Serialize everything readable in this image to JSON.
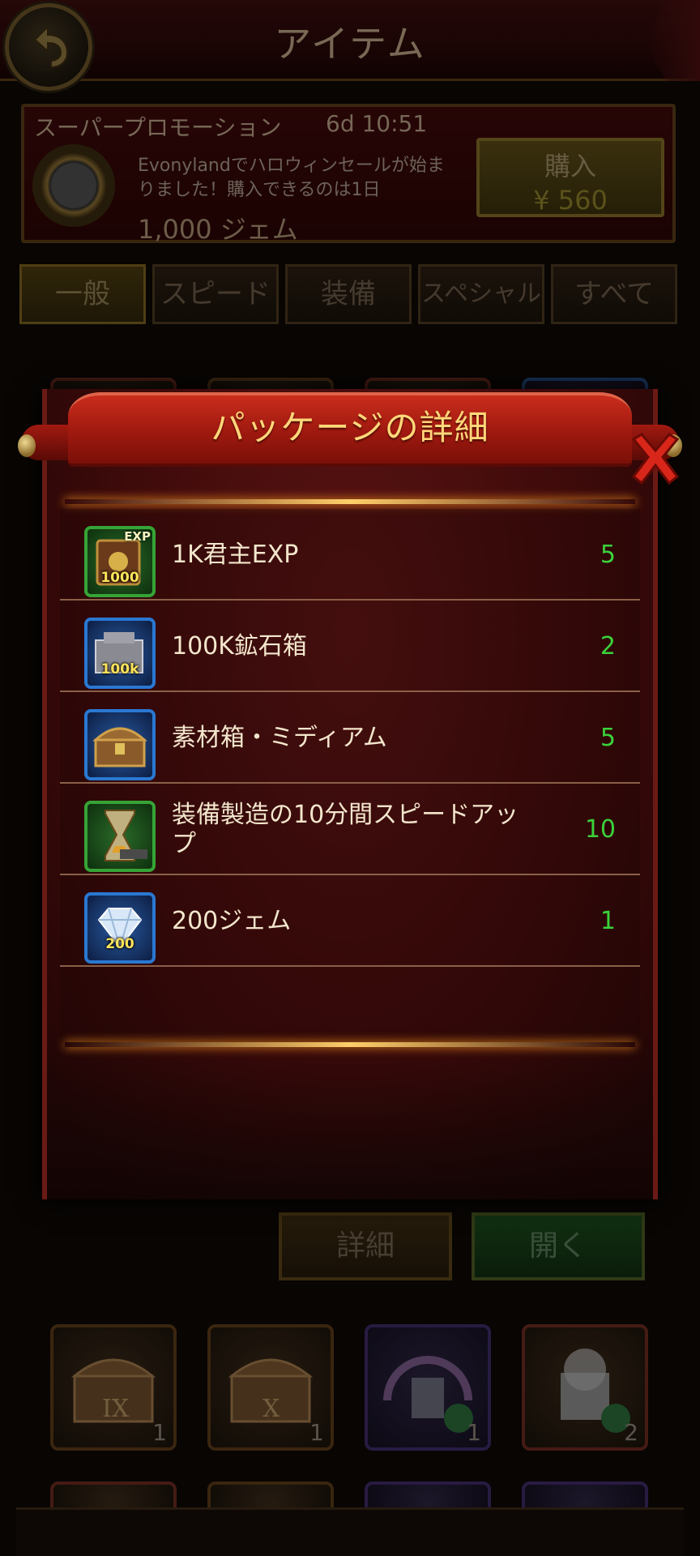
{
  "header": {
    "title": "アイテム"
  },
  "promo": {
    "title": "スーパープロモーション",
    "timer": "6d 10:51",
    "description": "Evonylandでハロウィンセールが始まりました！購入できるのは1日",
    "amount": "1,000 ジェム",
    "buy_label": "購入",
    "buy_price": "¥ 560"
  },
  "tabs": [
    "一般",
    "スピード",
    "装備",
    "スペシャル",
    "すべて"
  ],
  "actions": {
    "detail": "詳細",
    "open": "開く"
  },
  "grid_counts": [
    "1",
    "1",
    "1",
    "2"
  ],
  "grid_badges": [
    "IX",
    "X"
  ],
  "modal": {
    "title": "パッケージの詳細",
    "items": [
      {
        "name": "1K君主EXP",
        "qty": "5",
        "icon": "exp-book-icon",
        "icon_label": "1000",
        "icon_tag": "EXP"
      },
      {
        "name": "100K鉱石箱",
        "qty": "2",
        "icon": "ore-box-icon",
        "icon_label": "100k"
      },
      {
        "name": "素材箱・ミディアム",
        "qty": "5",
        "icon": "material-chest-icon"
      },
      {
        "name": "装備製造の10分間スピードアップ",
        "qty": "10",
        "icon": "hourglass-anvil-icon"
      },
      {
        "name": "200ジェム",
        "qty": "1",
        "icon": "gem-icon",
        "icon_label": "200"
      }
    ]
  },
  "colors": {
    "qty_green": "#3ad23a",
    "title_gold": "#ffd77a",
    "modal_red": "#5a1313"
  }
}
